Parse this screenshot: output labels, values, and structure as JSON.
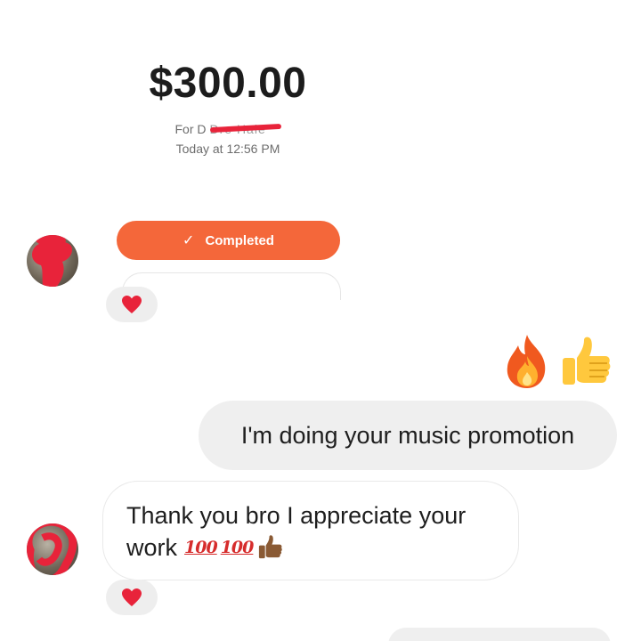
{
  "payment": {
    "amount": "$300.00",
    "for_prefix": "For D",
    "for_name_redacted": "Dre Hale",
    "time": "Today at 12:56 PM",
    "status_button": "Completed"
  },
  "messages": {
    "outgoing_text": "I'm doing your music promotion",
    "incoming_line1": "Thank you bro I appreciate your",
    "incoming_line2": "work",
    "incoming_emoji_text": [
      "100",
      "100"
    ]
  },
  "icons": {
    "check": "✓",
    "reaction": "heart-icon",
    "fire": "fire-icon",
    "thumbs_up": "thumbs-up-icon"
  },
  "colors": {
    "accent": "#f4673a",
    "heart": "#e8233a",
    "bubble_gray": "#efefef"
  }
}
